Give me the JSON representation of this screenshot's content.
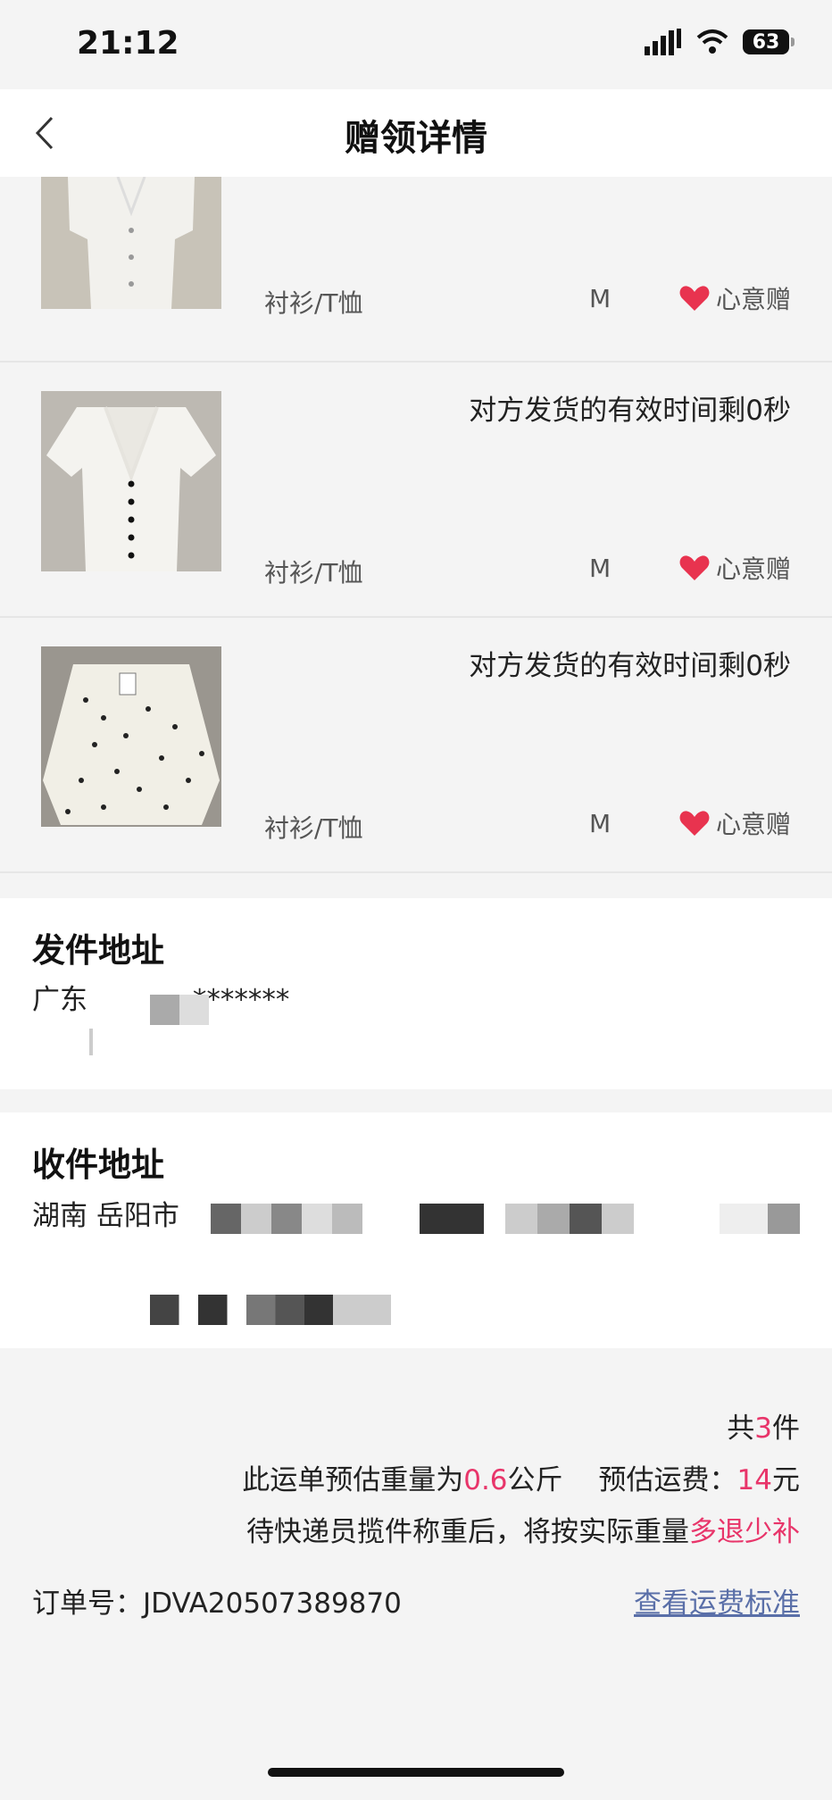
{
  "status_bar": {
    "time": "21:12",
    "battery": "63"
  },
  "nav": {
    "title": "赠领详情"
  },
  "gift_items": [
    {
      "validity": "",
      "category": "衬衫/T恤",
      "size": "M",
      "gift_type": "心意赠"
    },
    {
      "validity": "对方发货的有效时间剩0秒",
      "category": "衬衫/T恤",
      "size": "M",
      "gift_type": "心意赠"
    },
    {
      "validity": "对方发货的有效时间剩0秒",
      "category": "衬衫/T恤",
      "size": "M",
      "gift_type": "心意赠"
    }
  ],
  "sender": {
    "title": "发件地址",
    "line1": "广东",
    "masked": "*******"
  },
  "receiver": {
    "title": "收件地址",
    "line1": "湖南 岳阳市"
  },
  "summary": {
    "count_prefix": "共",
    "count": "3",
    "count_suffix": "件",
    "weight_prefix": "此运单预估重量为",
    "weight": "0.6",
    "weight_unit": "公斤",
    "fee_prefix": "预估运费：",
    "fee": "14",
    "fee_unit": "元",
    "note_prefix": "待快递员揽件称重后，将按实际重量",
    "note_highlight": "多退少补",
    "order_label": "订单号：",
    "order_number": "JDVA20507389870",
    "fee_standard_link": "查看运费标准"
  },
  "colors": {
    "accent": "#e8356a",
    "link": "#5a6fa8",
    "background": "#f4f4f4"
  }
}
